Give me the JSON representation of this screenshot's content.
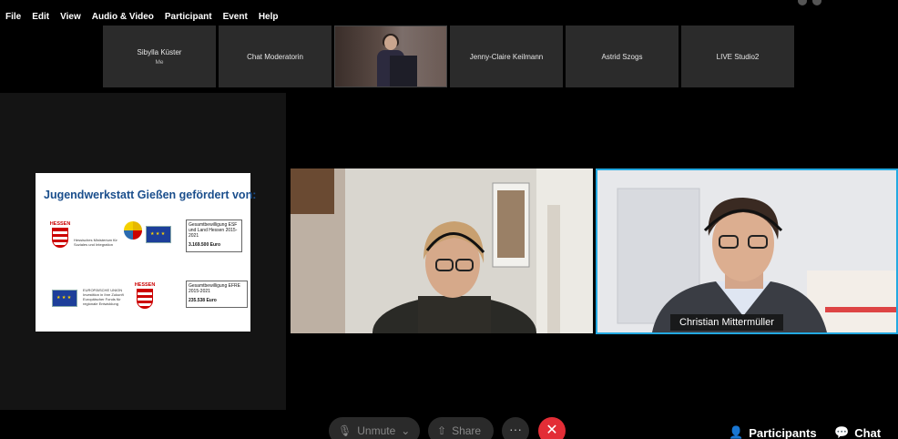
{
  "menu": [
    "File",
    "Edit",
    "View",
    "Audio & Video",
    "Participant",
    "Event",
    "Help"
  ],
  "thumbnails": [
    {
      "name": "Sibylla Küster",
      "sub": "Me"
    },
    {
      "name": "Chat Moderatorin",
      "sub": ""
    },
    {
      "name": "",
      "sub": ""
    },
    {
      "name": "Jenny-Claire Keilmann",
      "sub": ""
    },
    {
      "name": "Astrid Szogs",
      "sub": ""
    },
    {
      "name": "LIVE Studio2",
      "sub": ""
    }
  ],
  "slide": {
    "title": "Jugendwerkstatt Gießen gefördert von:",
    "hessen_label": "HESSEN",
    "ministry": "Hessisches Ministerium für Soziales und Integration",
    "eu_text": "EUROPÄISCHE UNION Investition in Ihre Zukunft Europäischer Fonds für regionale Entwicklung",
    "box1_title": "Gesamtbewilligung ESF und Land Hessen 2015-2021",
    "box1_amount": "3.169.500  Euro",
    "box2_title": "Gesamtbewilligung EFRE 2015-2021",
    "box2_amount": "235.538 Euro"
  },
  "active_speaker": {
    "name": "Christian Mittermüller"
  },
  "toolbar": {
    "unmute": "Unmute",
    "share": "Share",
    "more": "···",
    "leave": "✕",
    "participants": "Participants",
    "chat": "Chat"
  },
  "colors": {
    "active_border": "#23a9e1",
    "leave": "#e32d36"
  }
}
